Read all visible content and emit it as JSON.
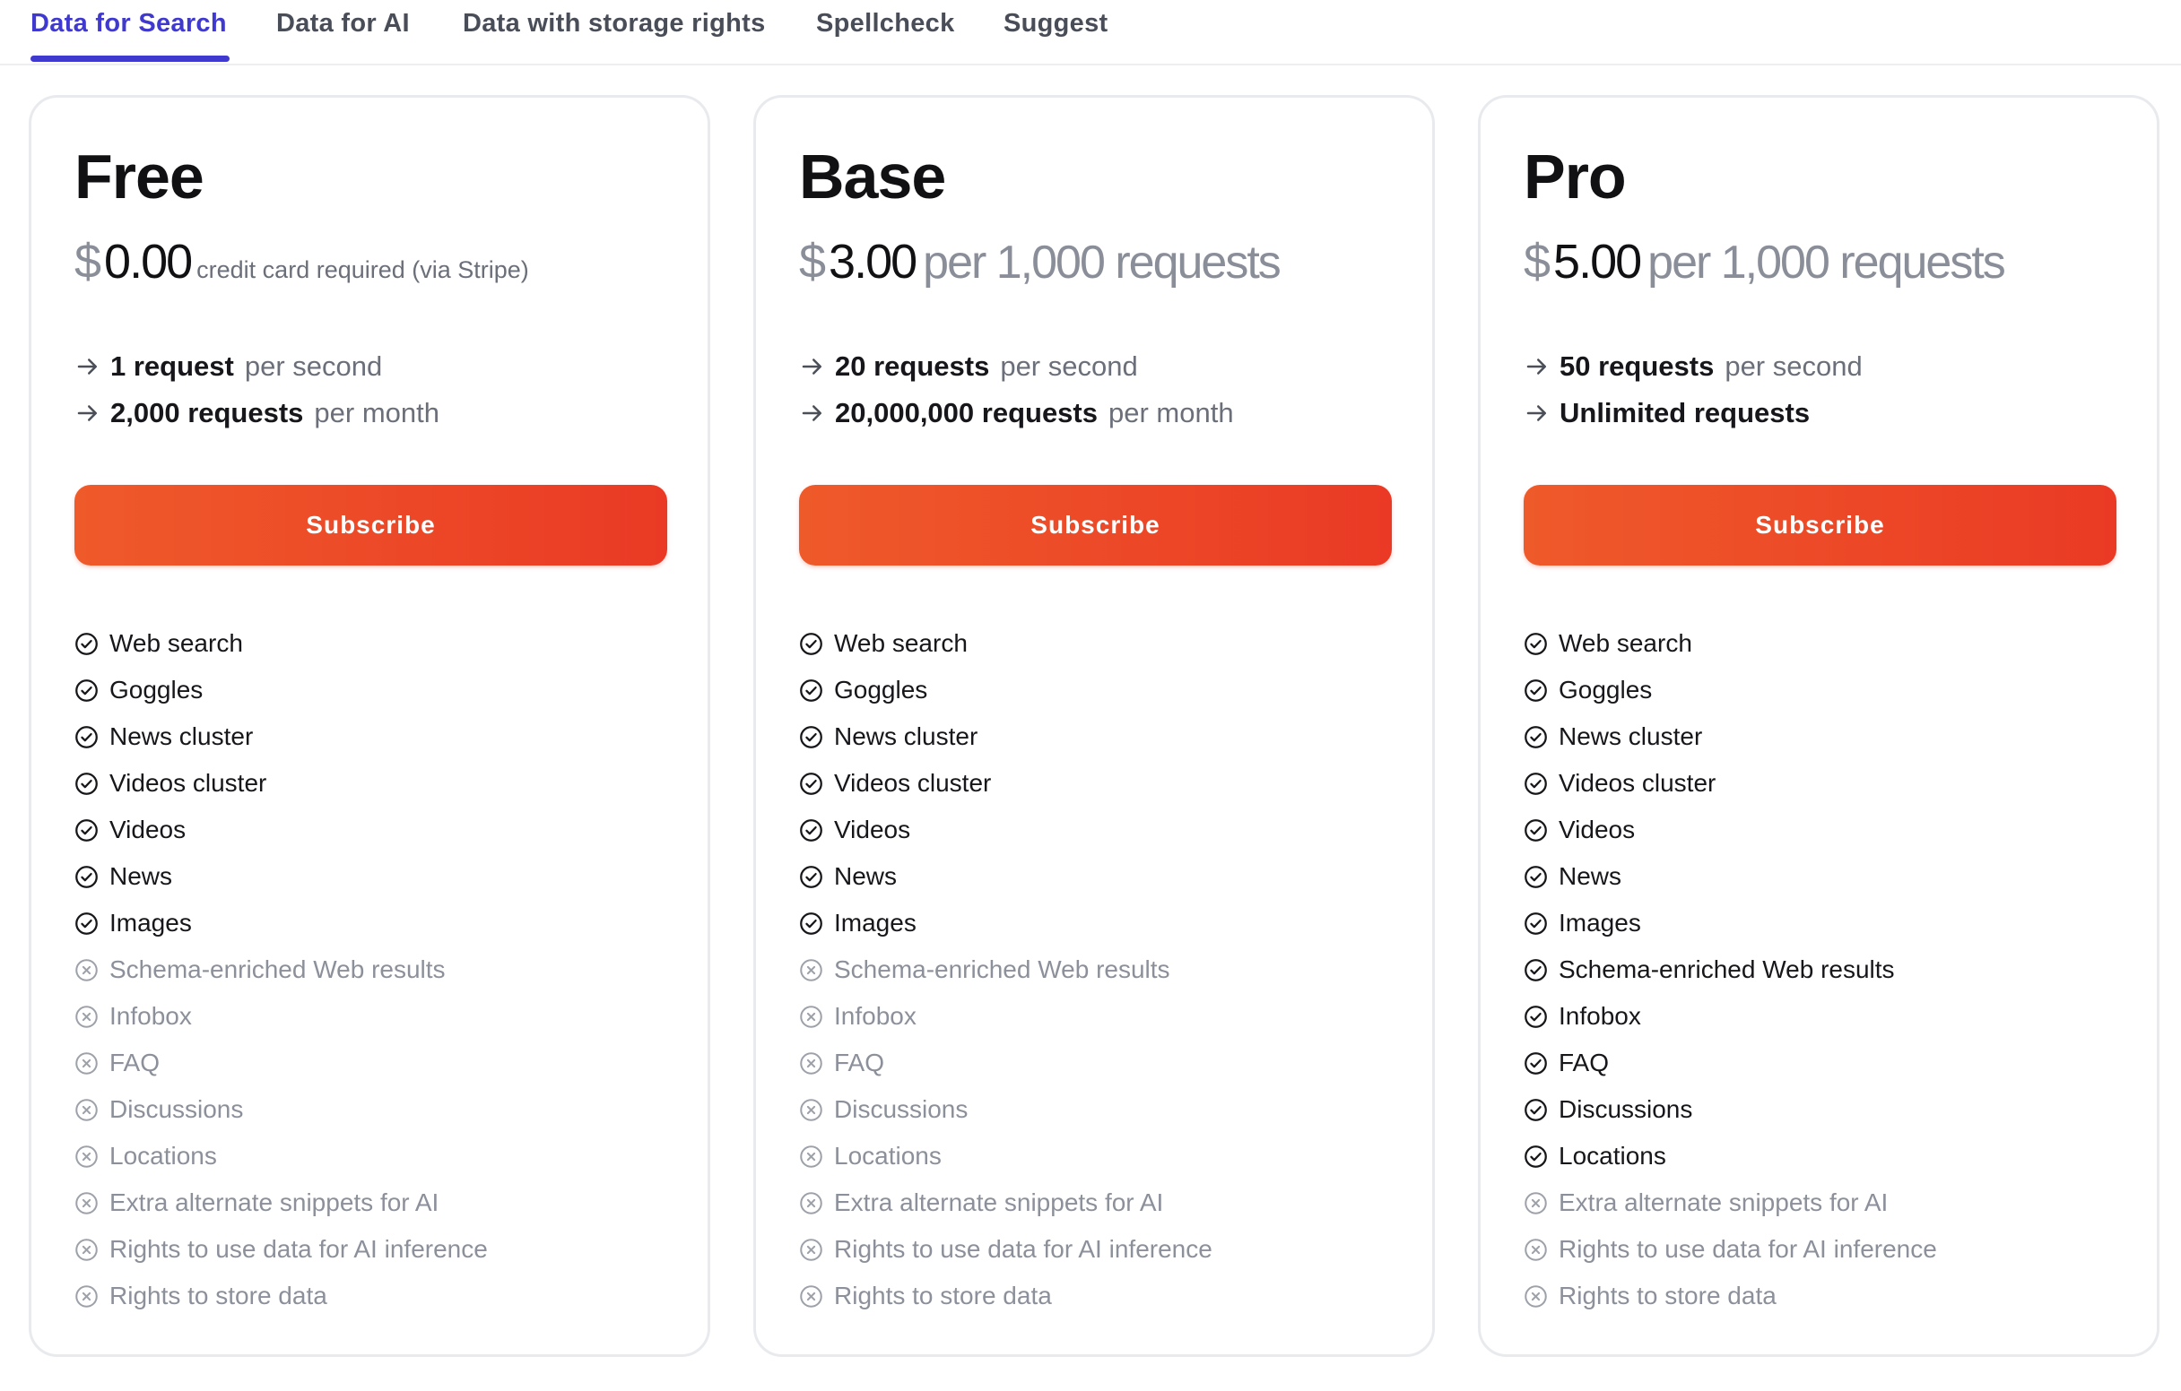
{
  "tabs": [
    {
      "label": "Data for Search",
      "active": true
    },
    {
      "label": "Data for AI",
      "active": false
    },
    {
      "label": "Data with storage rights",
      "active": false
    },
    {
      "label": "Spellcheck",
      "active": false
    },
    {
      "label": "Suggest",
      "active": false
    }
  ],
  "colors": {
    "accent": "#3f39d0",
    "subscribe_start": "#ef5a2a",
    "subscribe_end": "#ea3a25",
    "included": "#17171b",
    "excluded": "#8c909a"
  },
  "icons": {
    "limit": "arrow-right-icon",
    "included": "check-circle-icon",
    "excluded": "x-circle-icon"
  },
  "plans": [
    {
      "name": "Free",
      "currency": "$",
      "amount": "0.00",
      "price_note": "credit card required (via Stripe)",
      "limits": [
        {
          "strong": "1 request",
          "muted": "per second"
        },
        {
          "strong": "2,000 requests",
          "muted": "per month"
        }
      ],
      "subscribe_label": "Subscribe",
      "features": [
        {
          "label": "Web search",
          "included": true
        },
        {
          "label": "Goggles",
          "included": true
        },
        {
          "label": "News cluster",
          "included": true
        },
        {
          "label": "Videos cluster",
          "included": true
        },
        {
          "label": "Videos",
          "included": true
        },
        {
          "label": "News",
          "included": true
        },
        {
          "label": "Images",
          "included": true
        },
        {
          "label": "Schema-enriched Web results",
          "included": false
        },
        {
          "label": "Infobox",
          "included": false
        },
        {
          "label": "FAQ",
          "included": false
        },
        {
          "label": "Discussions",
          "included": false
        },
        {
          "label": "Locations",
          "included": false
        },
        {
          "label": "Extra alternate snippets for AI",
          "included": false
        },
        {
          "label": "Rights to use data for AI inference",
          "included": false
        },
        {
          "label": "Rights to store data",
          "included": false
        }
      ]
    },
    {
      "name": "Base",
      "currency": "$",
      "amount": "3.00",
      "price_note": "per 1,000 requests",
      "limits": [
        {
          "strong": "20 requests",
          "muted": "per second"
        },
        {
          "strong": "20,000,000 requests",
          "muted": "per month"
        }
      ],
      "subscribe_label": "Subscribe",
      "features": [
        {
          "label": "Web search",
          "included": true
        },
        {
          "label": "Goggles",
          "included": true
        },
        {
          "label": "News cluster",
          "included": true
        },
        {
          "label": "Videos cluster",
          "included": true
        },
        {
          "label": "Videos",
          "included": true
        },
        {
          "label": "News",
          "included": true
        },
        {
          "label": "Images",
          "included": true
        },
        {
          "label": "Schema-enriched Web results",
          "included": false
        },
        {
          "label": "Infobox",
          "included": false
        },
        {
          "label": "FAQ",
          "included": false
        },
        {
          "label": "Discussions",
          "included": false
        },
        {
          "label": "Locations",
          "included": false
        },
        {
          "label": "Extra alternate snippets for AI",
          "included": false
        },
        {
          "label": "Rights to use data for AI inference",
          "included": false
        },
        {
          "label": "Rights to store data",
          "included": false
        }
      ]
    },
    {
      "name": "Pro",
      "currency": "$",
      "amount": "5.00",
      "price_note": "per 1,000 requests",
      "limits": [
        {
          "strong": "50 requests",
          "muted": "per second"
        },
        {
          "strong": "Unlimited requests",
          "muted": ""
        }
      ],
      "subscribe_label": "Subscribe",
      "features": [
        {
          "label": "Web search",
          "included": true
        },
        {
          "label": "Goggles",
          "included": true
        },
        {
          "label": "News cluster",
          "included": true
        },
        {
          "label": "Videos cluster",
          "included": true
        },
        {
          "label": "Videos",
          "included": true
        },
        {
          "label": "News",
          "included": true
        },
        {
          "label": "Images",
          "included": true
        },
        {
          "label": "Schema-enriched Web results",
          "included": true
        },
        {
          "label": "Infobox",
          "included": true
        },
        {
          "label": "FAQ",
          "included": true
        },
        {
          "label": "Discussions",
          "included": true
        },
        {
          "label": "Locations",
          "included": true
        },
        {
          "label": "Extra alternate snippets for AI",
          "included": false
        },
        {
          "label": "Rights to use data for AI inference",
          "included": false
        },
        {
          "label": "Rights to store data",
          "included": false
        }
      ]
    }
  ]
}
